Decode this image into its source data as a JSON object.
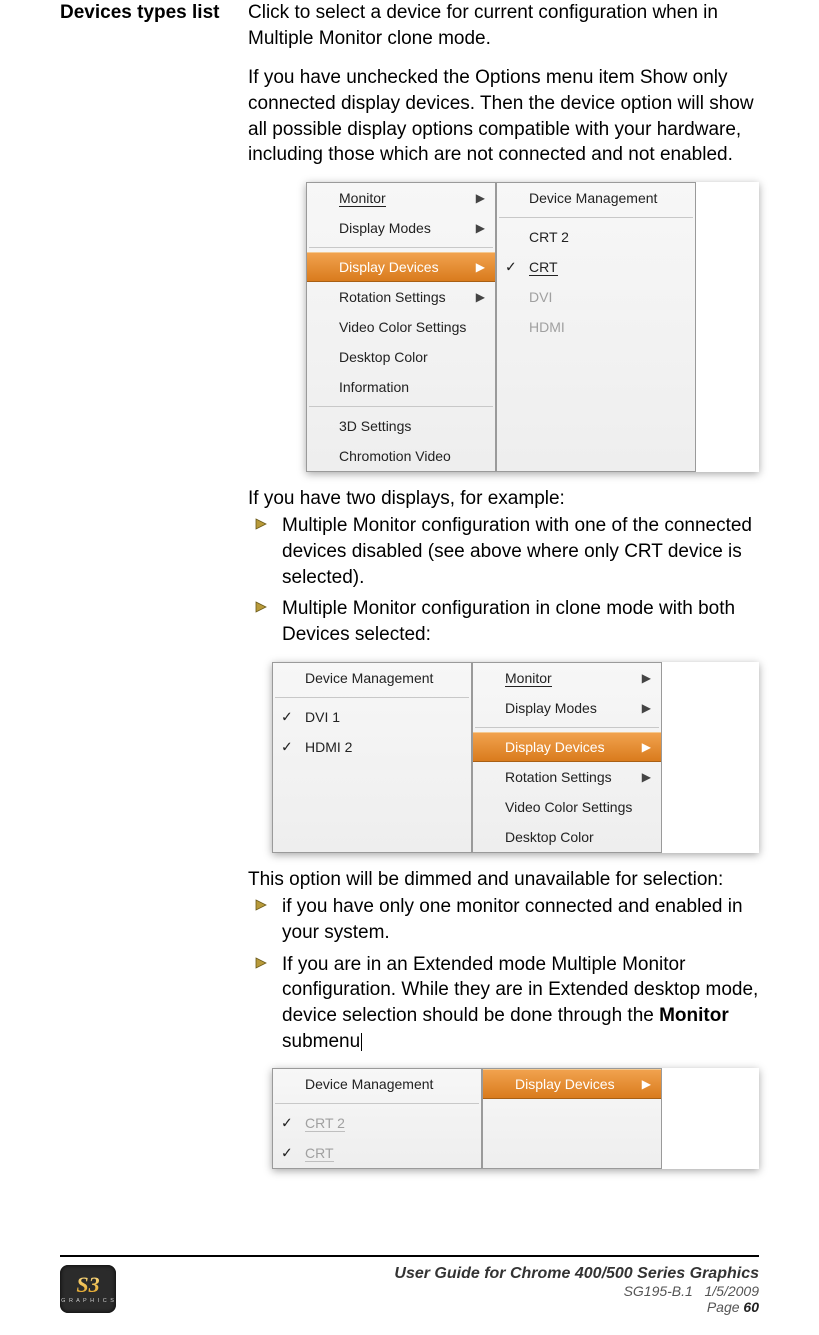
{
  "label": "Devices types list",
  "para1": "Click to select a device for current configuration when in Multiple Monitor clone mode.",
  "para2": "If you have unchecked the Options menu item Show only connected display devices. Then the device option will show all possible display options compatible with your hardware, including those which are not connected and not enabled.",
  "menu1": {
    "left": {
      "items": [
        {
          "label": "Monitor",
          "uidx": 0,
          "arrow": true
        },
        {
          "label": "Display Modes",
          "arrow": true
        }
      ],
      "group2": [
        {
          "label": "Display Devices",
          "arrow": true,
          "hover": true
        },
        {
          "label": "Rotation Settings",
          "arrow": true
        },
        {
          "label": "Video Color Settings"
        },
        {
          "label": "Desktop Color"
        },
        {
          "label": "Information"
        }
      ],
      "group3": [
        {
          "label": "3D Settings"
        },
        {
          "label": "Chromotion Video"
        }
      ]
    },
    "right": {
      "top": {
        "label": "Device Management"
      },
      "items": [
        {
          "label": "CRT 2",
          "uidx": 4
        },
        {
          "label": "CRT",
          "uidx": 0,
          "checked": true
        },
        {
          "label": "DVI",
          "disabled": true
        },
        {
          "label": "HDMI",
          "disabled": true
        }
      ]
    }
  },
  "intro2": "If you have two displays, for  example:",
  "bullets1": [
    "Multiple Monitor configuration with one of the connected devices disabled (see above where only CRT device is selected).",
    "Multiple Monitor configuration in clone mode with both Devices selected:"
  ],
  "menu2": {
    "left": {
      "top": {
        "label": "Device Management"
      },
      "items": [
        {
          "label": "DVI 1",
          "checked": true
        },
        {
          "label": "HDMI 2",
          "checked": true
        }
      ]
    },
    "right": {
      "items": [
        {
          "label": "Monitor",
          "uidx": 0,
          "arrow": true
        },
        {
          "label": "Display Modes",
          "arrow": true
        }
      ],
      "group2": [
        {
          "label": "Display Devices",
          "arrow": true,
          "hover": true
        },
        {
          "label": "Rotation Settings",
          "arrow": true
        },
        {
          "label": "Video Color Settings"
        },
        {
          "label": "Desktop Color"
        }
      ]
    }
  },
  "para3": "This option will be dimmed and unavailable for selection:",
  "bullets2": [
    {
      "text": "if you have only one monitor connected and enabled in your system."
    },
    {
      "pre": "If you are in an Extended mode Multiple Monitor configuration. While they are in Extended desktop mode, device selection should be done through the ",
      "bold": "Monitor",
      "post": " submenu"
    }
  ],
  "menu3": {
    "left": {
      "top": {
        "label": "Device Management"
      },
      "items": [
        {
          "label": "CRT 2",
          "uidx": 4,
          "disabled": true,
          "checked": true
        },
        {
          "label": "CRT",
          "uidx": 0,
          "disabled": true,
          "checked": true
        }
      ]
    },
    "right": {
      "items": [
        {
          "label": "Display Devices",
          "arrow": true,
          "hover": true
        }
      ]
    }
  },
  "footer": {
    "title": "User Guide for Chrome 400/500 Series Graphics",
    "line2a": "SG195-B.1",
    "line2b": "1/5/2009",
    "page_label": "Page ",
    "page_num": "60",
    "logo_text": "S3",
    "logo_sub": "G R A P H I C S"
  }
}
